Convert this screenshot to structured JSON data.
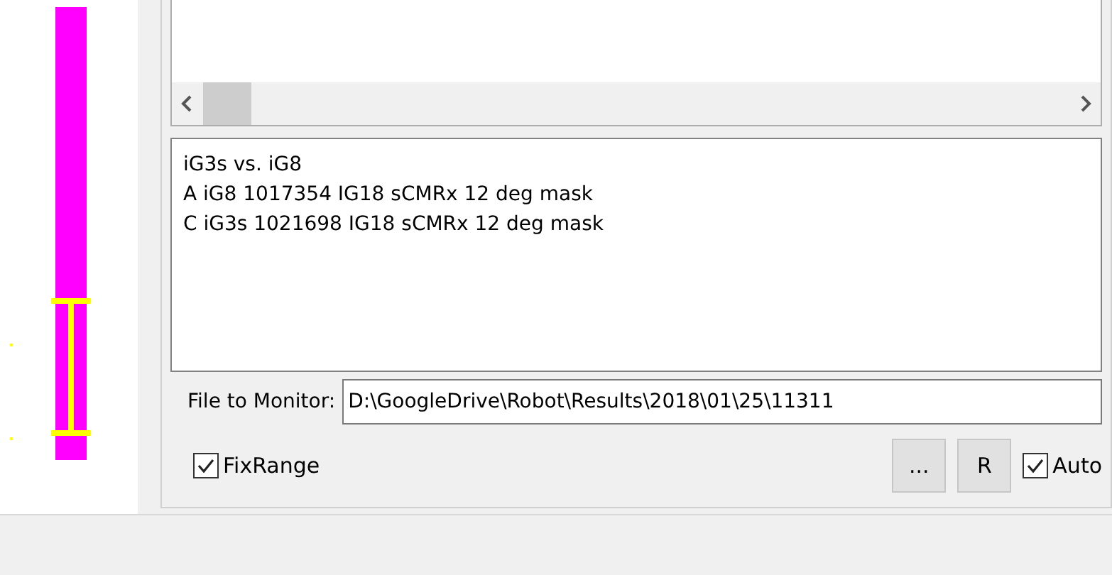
{
  "notes": {
    "lines": [
      "iG3s vs. iG8",
      "A iG8 1017354 IG18 sCMRx 12 deg mask",
      "C iG3s 1021698 IG18 sCMRx 12 deg mask"
    ]
  },
  "file_to_monitor": {
    "label": "File to Monitor:",
    "value": "D:\\GoogleDrive\\Robot\\Results\\2018\\01\\25\\11311"
  },
  "controls": [
    {
      "kind": "checkbox",
      "label": "FixRange",
      "checked": true
    },
    {
      "kind": "spacer"
    },
    {
      "kind": "button",
      "label": "..."
    },
    {
      "kind": "button",
      "label": "R"
    },
    {
      "kind": "checkbox",
      "label": "Auto",
      "checked": true
    }
  ]
}
